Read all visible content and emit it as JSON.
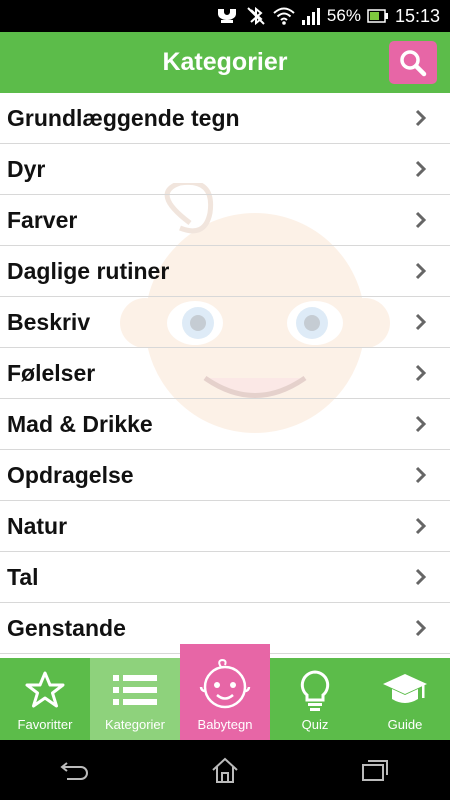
{
  "status_bar": {
    "battery_percent": "56%",
    "time": "15:13",
    "icons": [
      "notification-icon",
      "bluetooth-off-icon",
      "wifi-icon",
      "signal-icon",
      "battery-icon"
    ]
  },
  "header": {
    "title": "Kategorier",
    "search_icon": "search-icon"
  },
  "categories": [
    "Grundlæggende tegn",
    "Dyr",
    "Farver",
    "Daglige rutiner",
    "Beskriv",
    "Følelser",
    "Mad & Drikke",
    "Opdragelse",
    "Natur",
    "Tal",
    "Genstande"
  ],
  "tabs": [
    {
      "label": "Favoritter",
      "icon": "star-icon"
    },
    {
      "label": "Kategorier",
      "icon": "list-icon",
      "active": true
    },
    {
      "label": "Babytegn",
      "icon": "baby-face-icon"
    },
    {
      "label": "Quiz",
      "icon": "lightbulb-icon"
    },
    {
      "label": "Guide",
      "icon": "graduation-cap-icon"
    }
  ],
  "colors": {
    "primary_green": "#5cbc4a",
    "active_tab": "#8ed27c",
    "accent_pink": "#e766a6"
  }
}
